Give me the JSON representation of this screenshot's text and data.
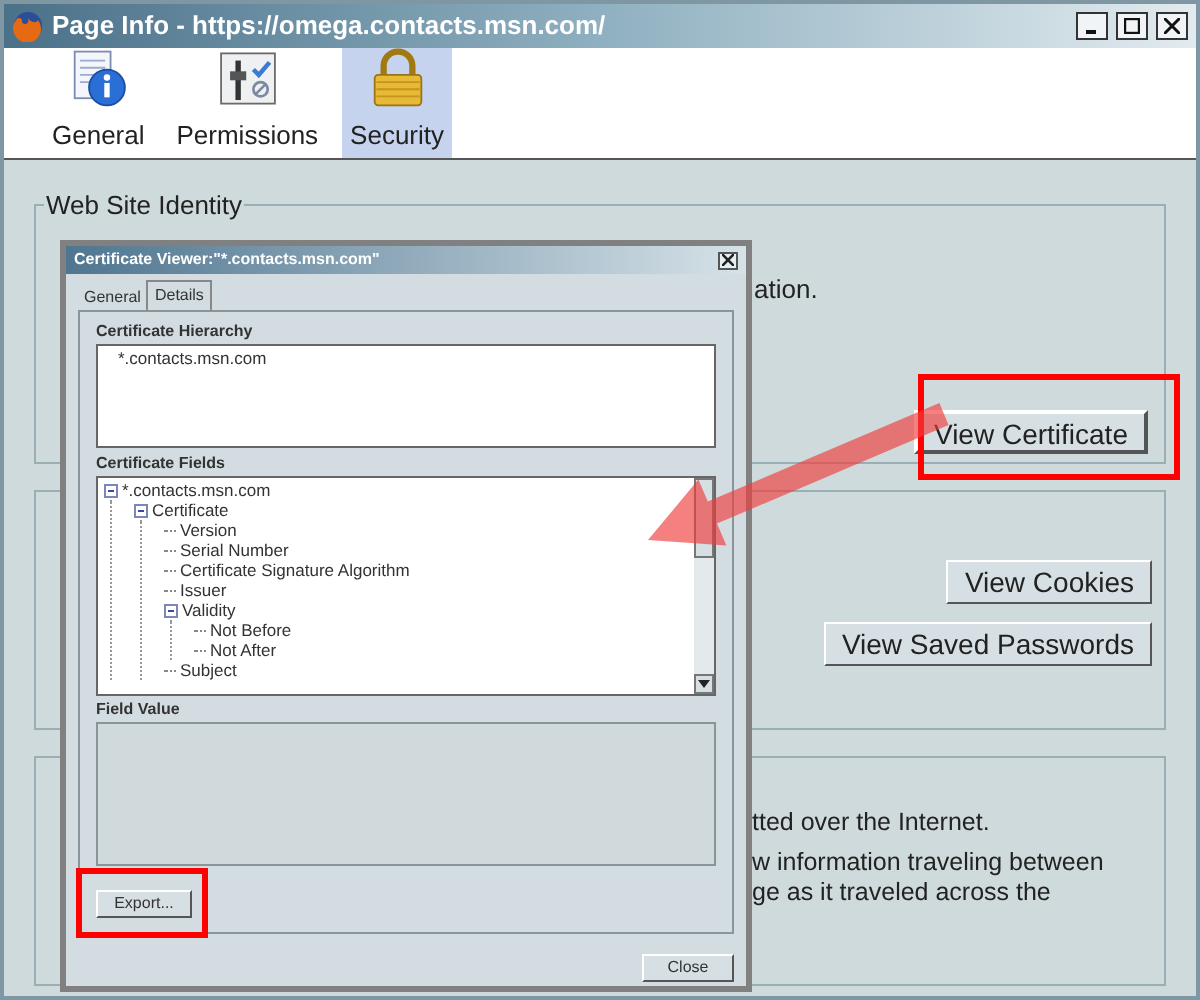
{
  "window": {
    "title": "Page Info - https://omega.contacts.msn.com/"
  },
  "tabs": [
    {
      "label": "General",
      "kind": "info",
      "selected": false
    },
    {
      "label": "Permissions",
      "kind": "permissions",
      "selected": false
    },
    {
      "label": "Security",
      "kind": "lock",
      "selected": true
    }
  ],
  "identity": {
    "legend": "Web Site Identity",
    "text": "ation.",
    "button": {
      "label": "View Certificate"
    }
  },
  "privacy": {
    "buttons": [
      {
        "label": "View Cookies"
      },
      {
        "label": "View Saved Passwords"
      }
    ]
  },
  "technical": {
    "lines": [
      "tted over the Internet.",
      "w information traveling between",
      "ge as it traveled across the"
    ]
  },
  "dialog": {
    "title": "Certificate Viewer:\"*.contacts.msn.com\"",
    "tabs": [
      {
        "label": "General",
        "selected": false
      },
      {
        "label": "Details",
        "selected": true
      }
    ],
    "hierarchy_label": "Certificate Hierarchy",
    "hierarchy": [
      "*.contacts.msn.com"
    ],
    "fields_label": "Certificate Fields",
    "fields": [
      {
        "label": "*.contacts.msn.com",
        "expanded": true,
        "children": [
          {
            "label": "Certificate",
            "expanded": true,
            "children": [
              {
                "label": "Version"
              },
              {
                "label": "Serial Number"
              },
              {
                "label": "Certificate Signature Algorithm"
              },
              {
                "label": "Issuer"
              },
              {
                "label": "Validity",
                "expanded": true,
                "children": [
                  {
                    "label": "Not Before"
                  },
                  {
                    "label": "Not After"
                  }
                ]
              },
              {
                "label": "Subject"
              }
            ]
          }
        ]
      }
    ],
    "value_label": "Field Value",
    "export_button": {
      "label": "Export..."
    },
    "close_button": {
      "label": "Close"
    }
  }
}
